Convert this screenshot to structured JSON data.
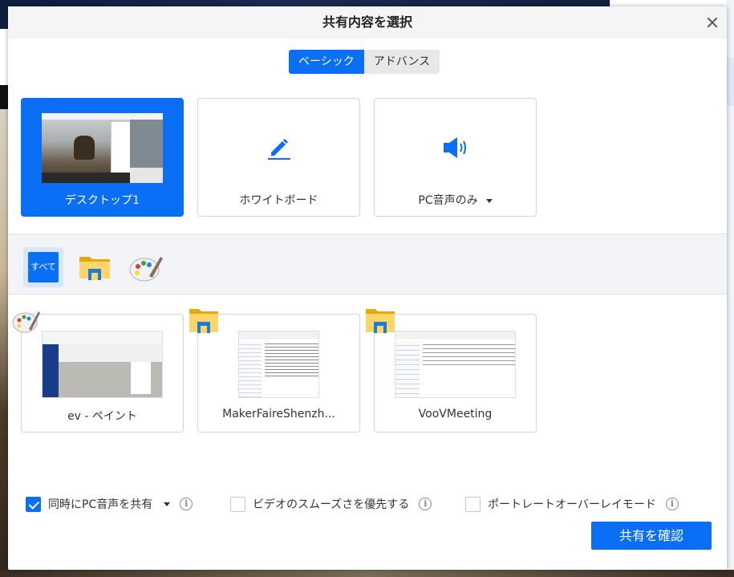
{
  "dialog": {
    "title": "共有内容を選択",
    "close_icon": "close-icon"
  },
  "tabs": [
    {
      "label": "ベーシック",
      "active": true
    },
    {
      "label": "アドバンス",
      "active": false
    }
  ],
  "cards": [
    {
      "label": "デスクトップ1",
      "selected": true,
      "icon": "desktop-thumbnail"
    },
    {
      "label": "ホワイトボード",
      "selected": false,
      "icon": "pencil-icon"
    },
    {
      "label": "PC音声のみ",
      "selected": false,
      "icon": "speaker-icon",
      "has_dropdown": true
    }
  ],
  "filters": [
    {
      "label": "すべて",
      "active": true
    },
    {
      "icon": "file-explorer-icon",
      "active": false
    },
    {
      "icon": "paint-palette-icon",
      "active": false
    }
  ],
  "windows": [
    {
      "label": "ev - ペイント",
      "badge": "paint-palette-icon"
    },
    {
      "label": "MakerFaireShenzh...",
      "badge": "file-explorer-icon"
    },
    {
      "label": "VooVMeeting",
      "badge": "file-explorer-icon"
    }
  ],
  "options": [
    {
      "label": "同時にPC音声を共有",
      "checked": true,
      "has_dropdown": true
    },
    {
      "label": "ビデオのスムーズさを優先する",
      "checked": false
    },
    {
      "label": "ポートレートオーバーレイモード",
      "checked": false
    }
  ],
  "confirm_label": "共有を確認",
  "colors": {
    "accent": "#0a6ff5",
    "card_border": "#d5d5d5",
    "filter_bg": "#f2f4f7"
  }
}
